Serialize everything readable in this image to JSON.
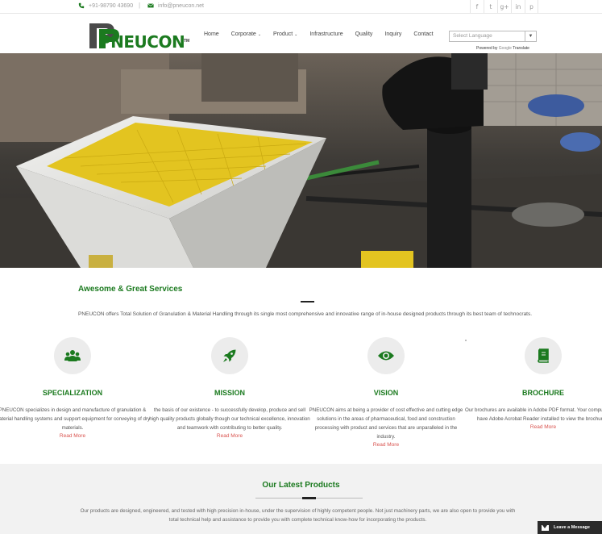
{
  "topbar": {
    "phone": "+91-98790 43690",
    "separator": "|",
    "email": "info@pneucon.net",
    "social": [
      "f",
      "t",
      "g+",
      "in",
      "p"
    ]
  },
  "header": {
    "logo_text": "PNEUCON",
    "logo_tm": "TM",
    "nav": [
      {
        "label": "Home"
      },
      {
        "label": "Corporate",
        "caret": "⌄"
      },
      {
        "label": "Product",
        "caret": "⌄"
      },
      {
        "label": "Infrastructure"
      },
      {
        "label": "Quality"
      },
      {
        "label": "Inquiry"
      },
      {
        "label": "Contact"
      }
    ],
    "language_select": "Select Language",
    "powered_by": "Powered by",
    "powered_google": "Google",
    "powered_translate": "Translate"
  },
  "services": {
    "title": "Awesome & Great Services",
    "intro": "PNEUCON offers Total Solution of Granulation & Material Handling through its single most comprehensive and innovative range of in-house designed products through its best team of technocrats.",
    "cards": [
      {
        "icon": "users-icon",
        "title": "SPECIALIZATION",
        "text": "PNEUCON specializes in design and manufacture of granulation & material handling systems and support equipment for conveying of dry materials.",
        "link": "Read More"
      },
      {
        "icon": "rocket-icon",
        "title": "MISSION",
        "text": "the basis of our existence - to successfully develop, produce and sell high quality products globally though our technical excellence, innovation and teamwork with contributing to better quality.",
        "link": "Read More"
      },
      {
        "icon": "eye-icon",
        "title": "VISION",
        "text": "PNEUCON aims at being a provider of cost effective and cutting edge solutions in the areas of pharmaceutical, food and construction processing with product and services that are unparalleled in the industry.",
        "link": "Read More"
      },
      {
        "icon": "book-icon",
        "title": "BROCHURE",
        "text": "Our brochures are available in Adobe PDF format. Your computer must have Adobe Acrobat Reader installed to view the brochures.",
        "link": "Read More"
      }
    ]
  },
  "latest": {
    "title": "Our Latest Products",
    "text": "Our products are designed, engineered, and tested with high precision in-house, under the supervision of highly competent people. Not just machinery parts, we are also open to provide you with total technical help and assistance to provide you with complete technical know-how for incorporating the products."
  },
  "chat": {
    "label": "Leave a Message"
  },
  "colors": {
    "brand_green": "#1b7a1f",
    "link_red": "#d9534f",
    "hero_yellow": "#e3c420"
  }
}
